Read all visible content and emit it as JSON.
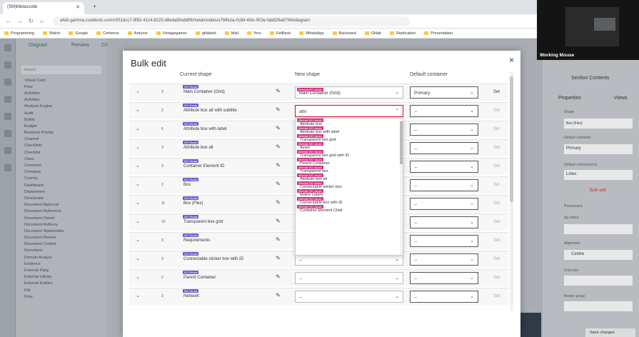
{
  "browser": {
    "tab_title": "(SM)Metascode",
    "url": "allab.gamma.codebots.com/c551dcc7-9f82-41c4-8223-d8eda90ab8f9/metamodels/a7bffe2a-0c8d-4fdc-903e-fab826ab7f4b/diagram",
    "bookmarks": [
      "Programming",
      "Watch",
      "Google",
      "Cerberus",
      "Arduino",
      "Vintagegamer",
      "gitlabwit",
      "Mail",
      "Yors",
      "FetBank",
      "WhatsApp",
      "Backward",
      "Gitlab",
      "Replication",
      "Presentation"
    ]
  },
  "left_panel": {
    "tabs": [
      "Diagram",
      "Preview",
      "Ch"
    ],
    "search_placeholder": "Search",
    "tree": [
      "Virtual Cash",
      "Flow",
      "Activities",
      "Activities",
      "Analysis Engine",
      "Audit",
      "Builds",
      "Budget",
      "Business Priority",
      "Channel",
      "Checklists",
      "Checklist",
      "Class",
      "Comment",
      "Company",
      "Country",
      "Dashboard",
      "Department",
      "Directorate",
      "Document Approval",
      "Document Reference",
      "Document Owner",
      "Document Refinery",
      "Document Stakeholder",
      "Document Review",
      "Document Control",
      "Document",
      "Domain Analyst",
      "Evidence",
      "External Party",
      "External Library",
      "External Entities",
      "File",
      "Flow"
    ]
  },
  "right_panel": {
    "title": "Section Contents",
    "tabs": [
      "Properties",
      "Views"
    ],
    "labels": [
      "Shape",
      "Default container",
      "Default connected to",
      "Parameters",
      "bg colour",
      "Alignment",
      "Font size",
      "Border group"
    ],
    "values": [
      "Box (Flex)",
      "Primary",
      "Lines",
      "Centre"
    ],
    "link": "Bulk edit",
    "button": "Save changes"
  },
  "webcam": {
    "label": "Working Mouse"
  },
  "modal": {
    "title": "Bulk edit",
    "close": "×",
    "headers": {
      "current": "Current shape",
      "new": "New shape",
      "default": "Default container"
    },
    "rows": [
      {
        "count": "3",
        "badge": "ISO Visuals",
        "name": "Main Container (Grid)",
        "new_badge": "Alternate ISO visuals",
        "new_value": "Main Container (Grid)",
        "default": "Primary",
        "set": "Set",
        "active": false,
        "set_dim": false
      },
      {
        "count": "2",
        "badge": "ISO Visuals",
        "name": "Attribute box alt with subtitle",
        "new_badge": "",
        "new_value": "attri",
        "default": "--",
        "set": "Set",
        "active": true,
        "set_dim": true
      },
      {
        "count": "6",
        "badge": "ISO Visuals",
        "name": "Attribute box with label",
        "new_badge": "",
        "new_value": "",
        "default": "--",
        "set": "Set",
        "active": false,
        "set_dim": true
      },
      {
        "count": "3",
        "badge": "ISO Visuals",
        "name": "Attribute box alt",
        "new_badge": "",
        "new_value": "",
        "default": "--",
        "set": "Set",
        "active": false,
        "set_dim": true
      },
      {
        "count": "3",
        "badge": "ISO Visuals",
        "name": "Container Element ID",
        "new_badge": "",
        "new_value": "",
        "default": "--",
        "set": "Set",
        "active": false,
        "set_dim": true
      },
      {
        "count": "2",
        "badge": "ISO Visuals",
        "name": "Box",
        "new_badge": "",
        "new_value": "",
        "default": "--",
        "set": "Set",
        "active": false,
        "set_dim": true
      },
      {
        "count": "11",
        "badge": "ISO Visuals",
        "name": "Box (Flex)",
        "new_badge": "",
        "new_value": "",
        "default": "--",
        "set": "Set",
        "active": false,
        "set_dim": true
      },
      {
        "count": "10",
        "badge": "ISO Visuals",
        "name": "Transparent box grid",
        "new_badge": "",
        "new_value": "",
        "default": "--",
        "set": "Set",
        "active": false,
        "set_dim": true
      },
      {
        "count": "3",
        "badge": "ISO Visuals",
        "name": "Requirements",
        "new_badge": "",
        "new_value": "",
        "default": "--",
        "set": "Set",
        "active": false,
        "set_dim": true
      },
      {
        "count": "3",
        "badge": "ISO Visuals",
        "name": "Connectable sticker box with ID",
        "new_badge": "",
        "new_value": "--",
        "default": "--",
        "set": "Set",
        "active": false,
        "set_dim": true
      },
      {
        "count": "2",
        "badge": "ISO Visuals",
        "name": "Parent Container",
        "new_badge": "",
        "new_value": "--",
        "default": "--",
        "set": "Set",
        "active": false,
        "set_dim": true
      },
      {
        "count": "3",
        "badge": "ISO Visuals",
        "name": "Network",
        "new_badge": "",
        "new_value": "--",
        "default": "--",
        "set": "Set",
        "active": false,
        "set_dim": true
      }
    ],
    "dropdown_badge": "Alternate ISO visuals",
    "dropdown_options": [
      "Attribute box",
      "Attribute box with label",
      "Transparent box grid",
      "Asset",
      "Transparent box grid with ID",
      "Parent Container",
      "Transparent box",
      "Attribute box alt",
      "Connectable sticker box",
      "Matrix Labels",
      "Connectable box with ID",
      "Container Element Child"
    ]
  }
}
